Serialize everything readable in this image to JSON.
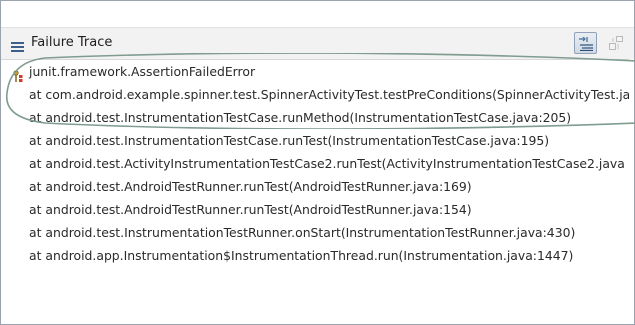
{
  "panel": {
    "title": "Failure Trace",
    "header_icon": "list-icon",
    "toolbar": {
      "filter_button_icon": "filter-stack-trace-icon",
      "compare_button_icon": "compare-result-icon"
    }
  },
  "trace": {
    "error_icon": "failure-icon",
    "lines": [
      "junit.framework.AssertionFailedError",
      "at com.android.example.spinner.test.SpinnerActivityTest.testPreConditions(SpinnerActivityTest.java",
      "at android.test.InstrumentationTestCase.runMethod(InstrumentationTestCase.java:205)",
      "at android.test.InstrumentationTestCase.runTest(InstrumentationTestCase.java:195)",
      "at android.test.ActivityInstrumentationTestCase2.runTest(ActivityInstrumentationTestCase2.java",
      "at android.test.AndroidTestRunner.runTest(AndroidTestRunner.java:169)",
      "at android.test.AndroidTestRunner.runTest(AndroidTestRunner.java:154)",
      "at android.test.InstrumentationTestRunner.onStart(InstrumentationTestRunner.java:430)",
      "at android.app.Instrumentation$InstrumentationThread.run(Instrumentation.java:1447)"
    ]
  },
  "colors": {
    "header_bg": "#f2f2f2",
    "highlight_outline": "#7f9c8f",
    "text": "#2a2a2a"
  }
}
